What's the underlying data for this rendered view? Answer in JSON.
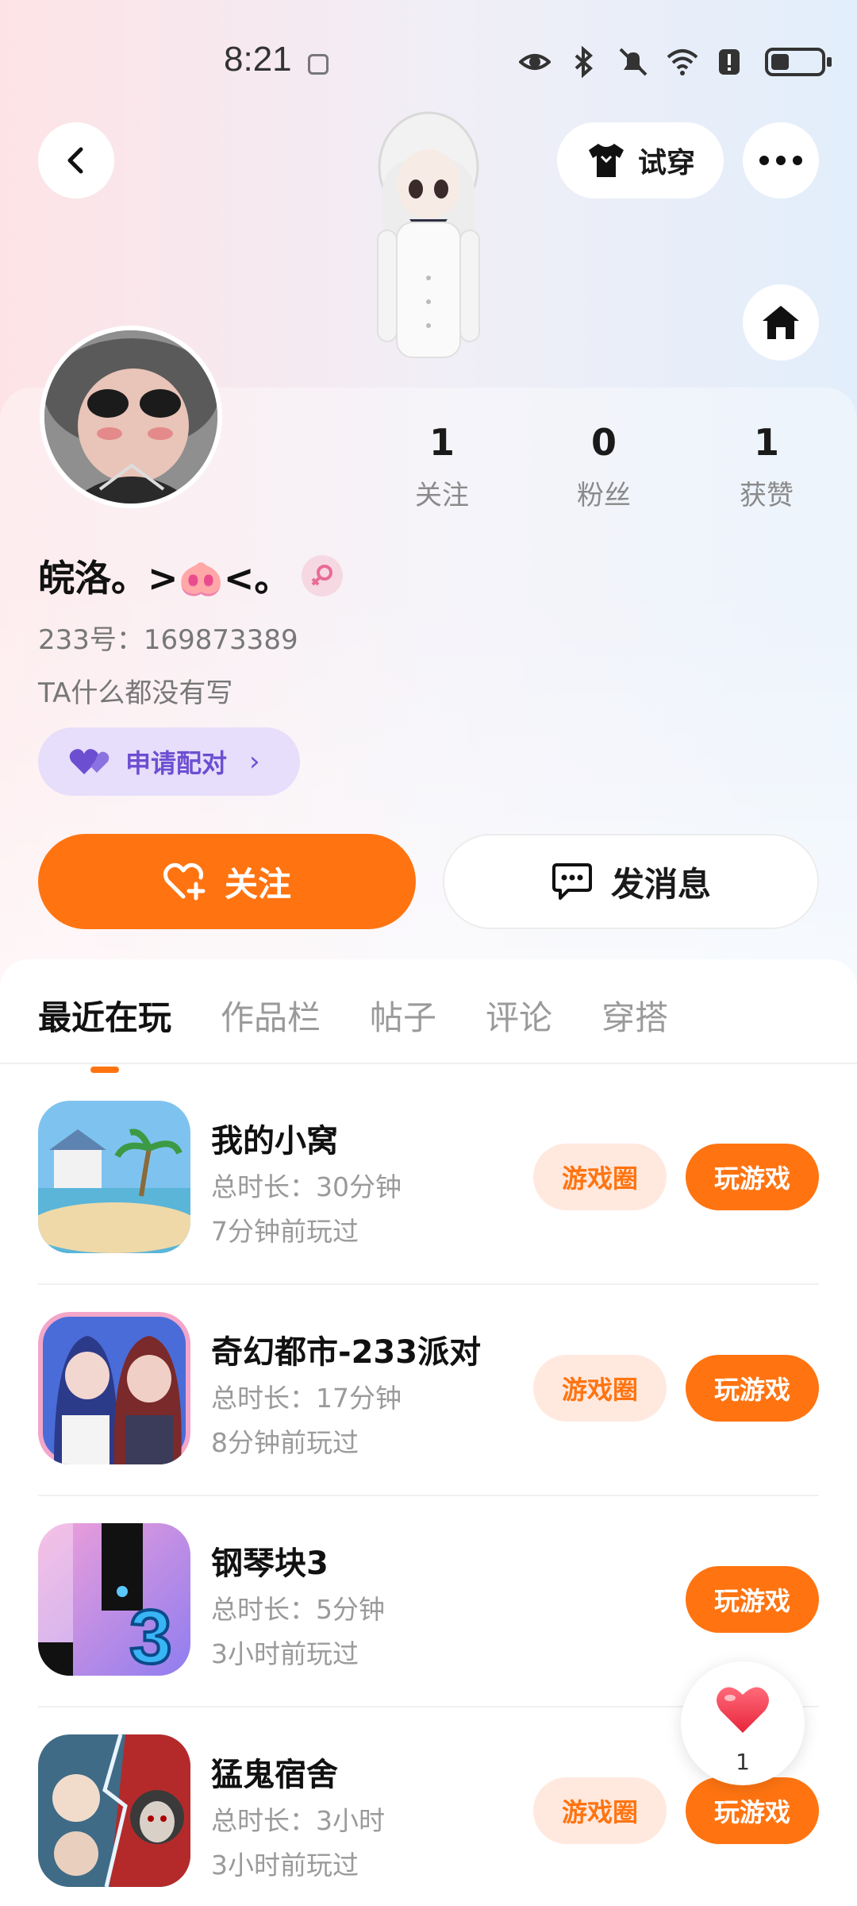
{
  "status": {
    "time": "8:21"
  },
  "header": {
    "tryon_label": "试穿"
  },
  "profile": {
    "name": "皖洛。>🐽<。",
    "uid": "233号：169873389",
    "bio": "TA什么都没有写",
    "pair_label": "申请配对",
    "stats": [
      {
        "value": "1",
        "label": "关注"
      },
      {
        "value": "0",
        "label": "粉丝"
      },
      {
        "value": "1",
        "label": "获赞"
      }
    ],
    "follow_label": "关注",
    "message_label": "发消息"
  },
  "tabs": [
    "最近在玩",
    "作品栏",
    "帖子",
    "评论",
    "穿搭"
  ],
  "games": [
    {
      "title": "我的小窝",
      "duration": "总时长：30分钟",
      "last_played": "7分钟前玩过",
      "circle_label": "游戏圈",
      "play_label": "玩游戏"
    },
    {
      "title": "奇幻都市-233派对",
      "duration": "总时长：17分钟",
      "last_played": "8分钟前玩过",
      "circle_label": "游戏圈",
      "play_label": "玩游戏"
    },
    {
      "title": "钢琴块3",
      "duration": "总时长：5分钟",
      "last_played": "3小时前玩过",
      "play_label": "玩游戏"
    },
    {
      "title": "猛鬼宿舍",
      "duration": "总时长：3小时",
      "last_played": "3小时前玩过",
      "circle_label": "游戏圈",
      "play_label": "玩游戏"
    }
  ],
  "like": {
    "count": "1"
  },
  "colors": {
    "accent": "#ff7411",
    "pair_purple": "#6c4fd1"
  }
}
